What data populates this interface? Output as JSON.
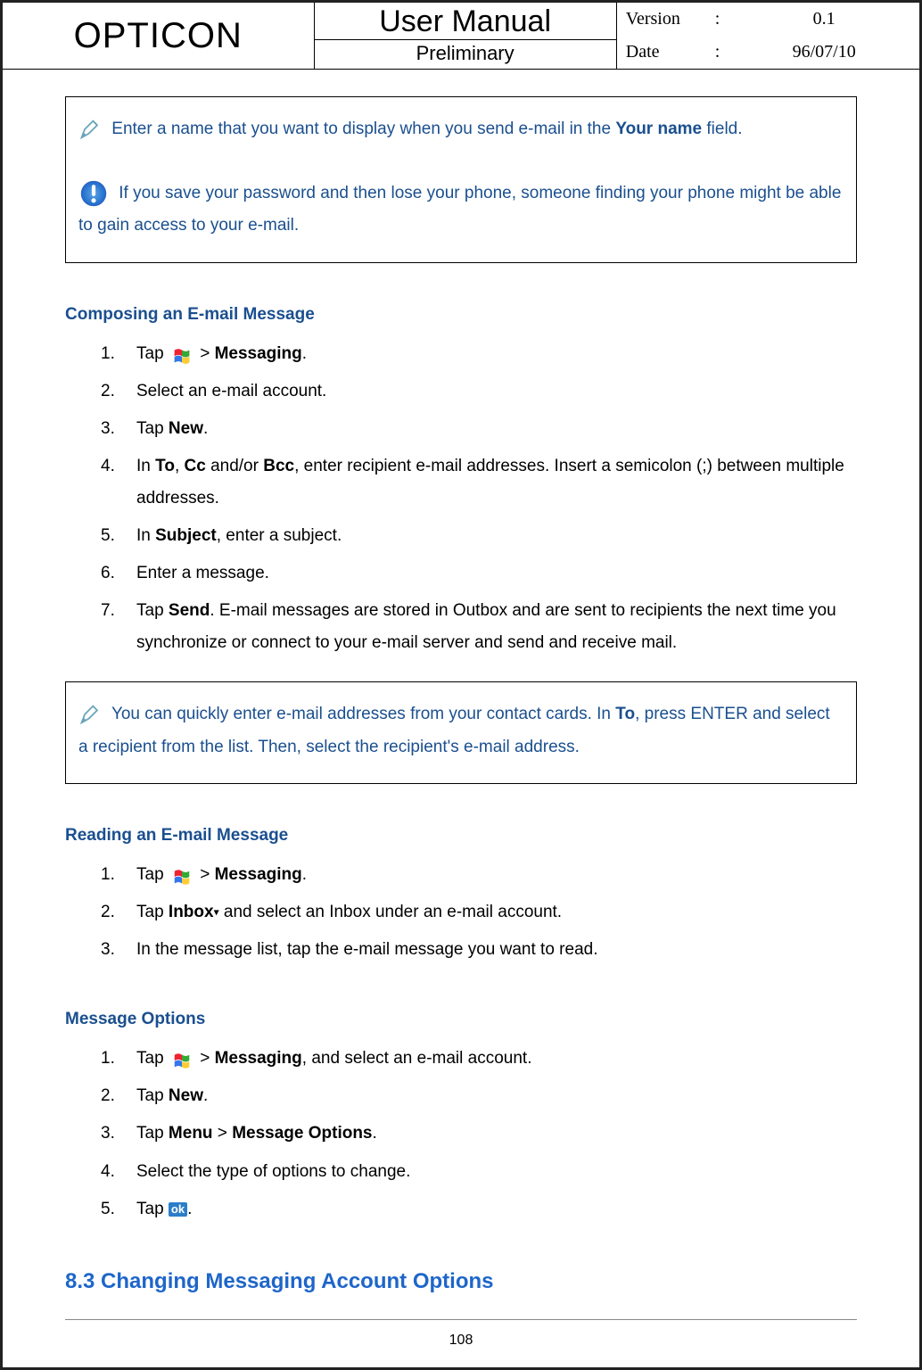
{
  "header": {
    "brand": "OPTICON",
    "title": "User Manual",
    "subtitle": "Preliminary",
    "version_label": "Version",
    "version_value": "0.1",
    "date_label": "Date",
    "date_value": "96/07/10",
    "colon": ":"
  },
  "tip1_a": "Enter a name that you want to display when you send e-mail in the ",
  "tip1_b": "Your name",
  "tip1_c": " field.",
  "warn1": " If you save your password and then lose your phone, someone finding your phone might be able to gain access to your e-mail.",
  "sec1_title": "Composing an E-mail Message",
  "sec1": {
    "i1a": "Tap ",
    "i1b": " > ",
    "i1c": "Messaging",
    "i1d": ".",
    "i2": "Select an e-mail account.",
    "i3a": "Tap ",
    "i3b": "New",
    "i3c": ".",
    "i4a": "In ",
    "i4b": "To",
    "i4c": ", ",
    "i4d": "Cc",
    "i4e": " and/or ",
    "i4f": "Bcc",
    "i4g": ", enter recipient e-mail addresses. Insert a semicolon (;) between multiple addresses.",
    "i5a": "In ",
    "i5b": "Subject",
    "i5c": ", enter a subject.",
    "i6": "Enter a message.",
    "i7a": "Tap ",
    "i7b": "Send",
    "i7c": ". E-mail messages are stored in Outbox and are sent to recipients the next time you synchronize or connect to your e-mail server and send and receive mail."
  },
  "tip2_a": " You can quickly enter e-mail addresses from your contact cards. In ",
  "tip2_b": "To",
  "tip2_c": ", press ENTER and select a recipient from the list. Then, select the recipient's e-mail address.",
  "sec2_title": "Reading an E-mail Message",
  "sec2": {
    "i1a": "Tap ",
    "i1b": " > ",
    "i1c": "Messaging",
    "i1d": ".",
    "i2a": "Tap ",
    "i2b": "Inbox",
    "i2c": " and select an Inbox under an e-mail account.",
    "i3": "In the message list, tap the e-mail message you want to read."
  },
  "sec3_title": "Message Options",
  "sec3": {
    "i1a": "Tap ",
    "i1b": " > ",
    "i1c": "Messaging",
    "i1d": ", and select an e-mail account.",
    "i2a": "Tap ",
    "i2b": "New",
    "i2c": ".",
    "i3a": "Tap ",
    "i3b": "Menu",
    "i3c": " > ",
    "i3d": "Message Options",
    "i3e": ".",
    "i4": "Select the type of options to change.",
    "i5a": "Tap ",
    "i5b": "ok",
    "i5c": "."
  },
  "big_section": "8.3 Changing Messaging Account Options",
  "page_number": "108",
  "dropdown_tri": "▾"
}
